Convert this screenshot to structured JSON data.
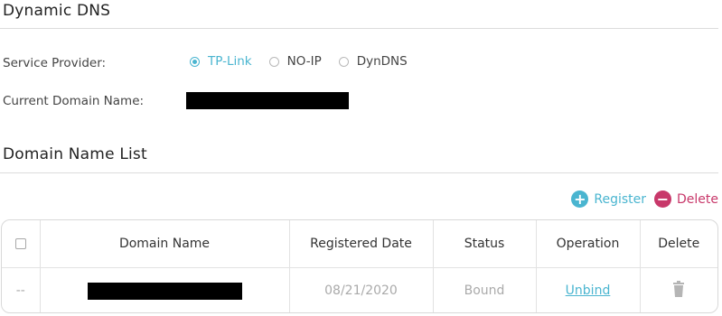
{
  "ddns": {
    "title": "Dynamic DNS",
    "service_provider_label": "Service Provider:",
    "providers": [
      {
        "label": "TP-Link",
        "selected": true
      },
      {
        "label": "NO-IP",
        "selected": false
      },
      {
        "label": "DynDNS",
        "selected": false
      }
    ],
    "current_domain_label": "Current Domain Name:"
  },
  "domain_list": {
    "title": "Domain Name List",
    "register_label": "Register",
    "delete_label": "Delete",
    "columns": [
      "Domain Name",
      "Registered Date",
      "Status",
      "Operation",
      "Delete"
    ],
    "rows": [
      {
        "checkbox": "--",
        "registered_date": "08/21/2020",
        "status": "Bound",
        "operation": "Unbind"
      }
    ]
  },
  "colors": {
    "accent": "#4ab5d0",
    "danger": "#c8386a"
  }
}
